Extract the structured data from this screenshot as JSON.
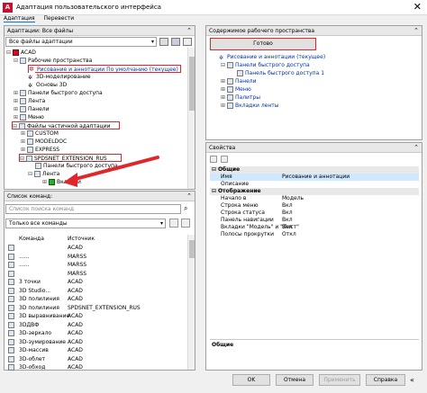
{
  "window": {
    "title": "Адаптация пользовательского интерфейса",
    "close_glyph": "✕",
    "app_glyph": "A"
  },
  "tabs": [
    {
      "label": "Адаптация"
    },
    {
      "label": "Перевести"
    }
  ],
  "left_top": {
    "header": "Адаптации: Все файлы",
    "filter_value": "Все файлы адаптации",
    "tree": [
      {
        "label": "ACAD",
        "level": 0
      },
      {
        "label": "Рабочие пространства",
        "level": 1
      },
      {
        "label": "Рисование и аннотации По умолчанию (текущее)",
        "level": 2
      },
      {
        "label": "3D-моделирование",
        "level": 2
      },
      {
        "label": "Основы 3D",
        "level": 2
      },
      {
        "label": "Панели быстрого доступа",
        "level": 1
      },
      {
        "label": "Лента",
        "level": 1
      },
      {
        "label": "Панели",
        "level": 1
      },
      {
        "label": "Меню",
        "level": 1
      },
      {
        "label": "Файлы частичной адаптации",
        "level": 1
      },
      {
        "label": "CUSTOM",
        "level": 2
      },
      {
        "label": "MODELDOC",
        "level": 2
      },
      {
        "label": "EXPRESS",
        "level": 2
      },
      {
        "label": "SPDSNET_EXTENSION_RUS",
        "level": 2
      },
      {
        "label": "Панели быстрого доступа",
        "level": 3
      },
      {
        "label": "Лента",
        "level": 3
      },
      {
        "label": "Вкладки",
        "level": 4
      }
    ]
  },
  "commands": {
    "header": "Список команд:",
    "search_placeholder": "Список поиска команд",
    "filter_value": "Только все команды",
    "columns": [
      "Команда",
      "Источник"
    ],
    "rows": [
      {
        "name": "",
        "source": "ACAD"
      },
      {
        "name": "......",
        "source": "MARSS"
      },
      {
        "name": "......",
        "source": "MARSS"
      },
      {
        "name": "",
        "source": "MARSS"
      },
      {
        "name": "3 точки",
        "source": "ACAD"
      },
      {
        "name": "3D Studio...",
        "source": "ACAD"
      },
      {
        "name": "3D полилиния",
        "source": "ACAD"
      },
      {
        "name": "3D полилиния",
        "source": "SPDSNET_EXTENSION_RUS"
      },
      {
        "name": "3D выравнивание",
        "source": "ACAD"
      },
      {
        "name": "3DДВФ",
        "source": "ACAD"
      },
      {
        "name": "3D-зеркало",
        "source": "ACAD"
      },
      {
        "name": "3D-зумирование",
        "source": "ACAD"
      },
      {
        "name": "3D-массив",
        "source": "ACAD"
      },
      {
        "name": "3D-облет",
        "source": "ACAD"
      },
      {
        "name": "3D-обход",
        "source": "ACAD"
      }
    ]
  },
  "workspace": {
    "header": "Содержимое рабочего пространства",
    "done_label": "Готово",
    "tree": [
      {
        "label": "Рисование и аннотации (текущее)",
        "level": 0
      },
      {
        "label": "Панели быстрого доступа",
        "level": 1
      },
      {
        "label": "Панель быстрого доступа 1",
        "level": 2
      },
      {
        "label": "Панели",
        "level": 1
      },
      {
        "label": "Меню",
        "level": 1
      },
      {
        "label": "Палитры",
        "level": 1
      },
      {
        "label": "Вкладки ленты",
        "level": 1
      }
    ]
  },
  "properties": {
    "header": "Свойства",
    "groups": [
      {
        "name": "Общие",
        "rows": [
          {
            "key": "Имя",
            "value": "Рисование и аннотации"
          },
          {
            "key": "Описание",
            "value": ""
          }
        ]
      },
      {
        "name": "Отображение",
        "rows": [
          {
            "key": "Начало в",
            "value": "Модель"
          },
          {
            "key": "Строка меню",
            "value": "Вкл"
          },
          {
            "key": "Строка статуса",
            "value": "Вкл"
          },
          {
            "key": "Панель навигации",
            "value": "Вкл"
          },
          {
            "key": "Вкладки \"Модель\" и \"Лист\"",
            "value": "Вкл"
          },
          {
            "key": "Полосы прокрутки",
            "value": "Откл"
          }
        ]
      }
    ],
    "desc_title": "Общие"
  },
  "buttons": {
    "ok": "OK",
    "cancel": "Отмена",
    "apply": "Применить",
    "help": "Справка"
  },
  "colors": {
    "accent": "#0078d7",
    "highlight_red": "#e0262b",
    "tree_text_blue": "#0033aa"
  }
}
